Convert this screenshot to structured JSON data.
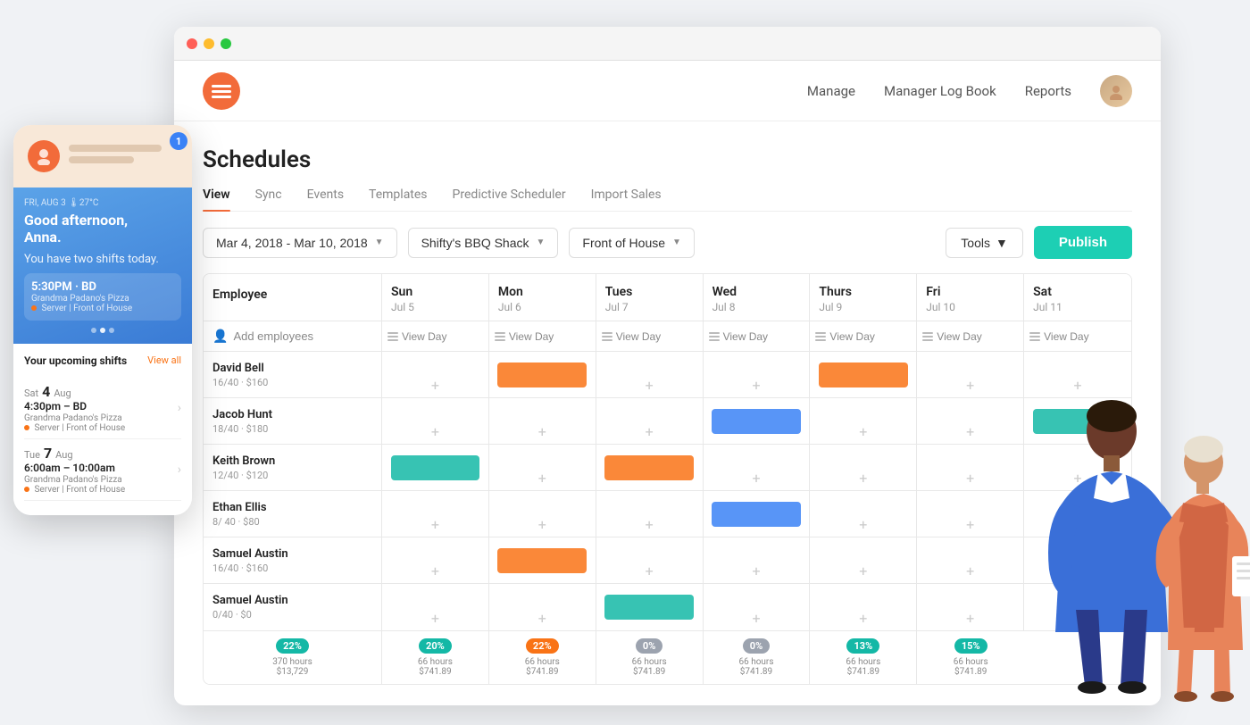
{
  "browser": {
    "dots": [
      "red",
      "yellow",
      "green"
    ]
  },
  "header": {
    "logo_icon": "☰",
    "nav": {
      "manage": "Manage",
      "manager_log_book": "Manager Log Book",
      "reports": "Reports"
    }
  },
  "page": {
    "title": "Schedules",
    "tabs": [
      {
        "id": "view",
        "label": "View",
        "active": true
      },
      {
        "id": "sync",
        "label": "Sync",
        "active": false
      },
      {
        "id": "events",
        "label": "Events",
        "active": false
      },
      {
        "id": "templates",
        "label": "Templates",
        "active": false
      },
      {
        "id": "predictive_scheduler",
        "label": "Predictive Scheduler",
        "active": false
      },
      {
        "id": "import_sales",
        "label": "Import Sales",
        "active": false
      }
    ]
  },
  "toolbar": {
    "date_range": "Mar 4, 2018 - Mar 10, 2018",
    "location": "Shifty's BBQ Shack",
    "department": "Front of House",
    "tools": "Tools",
    "publish": "Publish"
  },
  "schedule": {
    "columns": [
      {
        "label": "Employee",
        "date": ""
      },
      {
        "label": "Sun",
        "date": "Jul 5"
      },
      {
        "label": "Mon",
        "date": "Jul 6"
      },
      {
        "label": "Tues",
        "date": "Jul 7"
      },
      {
        "label": "Wed",
        "date": "Jul 8"
      },
      {
        "label": "Thurs",
        "date": "Jul 9"
      },
      {
        "label": "Fri",
        "date": "Jul 10"
      },
      {
        "label": "Sat",
        "date": "Jul 11"
      }
    ],
    "add_employees_btn": "Add employees",
    "view_day_btn": "View Day",
    "employees": [
      {
        "name": "David Bell",
        "stats": "16/40 · $160",
        "shifts": [
          null,
          "orange",
          null,
          null,
          "orange",
          null,
          null
        ]
      },
      {
        "name": "Jacob Hunt",
        "stats": "18/40 · $180",
        "shifts": [
          null,
          null,
          null,
          "blue",
          null,
          null,
          "teal",
          null
        ]
      },
      {
        "name": "Keith Brown",
        "stats": "12/40 · $120",
        "shifts": [
          "teal",
          null,
          "orange",
          null,
          null,
          null,
          null,
          "orange"
        ]
      },
      {
        "name": "Ethan Ellis",
        "stats": "8/ 40 · $80",
        "shifts": [
          null,
          null,
          null,
          "blue",
          null,
          null,
          null,
          null
        ]
      },
      {
        "name": "Samuel Austin",
        "stats": "16/40 · $160",
        "shifts": [
          null,
          "orange",
          null,
          null,
          null,
          null,
          null,
          null
        ]
      },
      {
        "name": "Samuel Austin",
        "stats": "0/40 · $0",
        "shifts": [
          null,
          null,
          "teal",
          null,
          null,
          null,
          null,
          null
        ]
      }
    ],
    "stats": [
      {
        "pct": "22%",
        "color": "teal",
        "hours": "370 hours",
        "dollars": "$13,729"
      },
      {
        "pct": "20%",
        "color": "teal",
        "hours": "66 hours",
        "dollars": "$741.89"
      },
      {
        "pct": "22%",
        "color": "orange",
        "hours": "66 hours",
        "dollars": "$741.89"
      },
      {
        "pct": "0%",
        "color": "gray",
        "hours": "66 hours",
        "dollars": "$741.89"
      },
      {
        "pct": "0%",
        "color": "gray",
        "hours": "66 hours",
        "dollars": "$741.89"
      },
      {
        "pct": "13%",
        "color": "teal",
        "hours": "66 hours",
        "dollars": "$741.89"
      },
      {
        "pct": "15%",
        "color": "teal",
        "hours": "66 hours",
        "dollars": "$741.89"
      }
    ]
  },
  "mobile": {
    "notification_count": "1",
    "greeting_prefix": "Good afternoon,",
    "greeting_name": "Anna.",
    "shift_message": "You have two shifts today.",
    "shift_time": "5:30PM · BD",
    "shift_place": "Grandma Padano's Pizza",
    "shift_role": "Server | Front of House",
    "upcoming_title": "Your upcoming shifts",
    "view_all": "View all",
    "upcoming_shifts": [
      {
        "day_label": "Sat 4",
        "month": "Aug",
        "time": "4:30pm – BD",
        "place": "Grandma Padano's Pizza",
        "role": "Server | Front of House"
      },
      {
        "day_label": "Tue 7",
        "month": "Aug",
        "time": "6:00am – 10:00am",
        "place": "Grandma Padano's Pizza",
        "role": "Server | Front of House"
      }
    ]
  }
}
